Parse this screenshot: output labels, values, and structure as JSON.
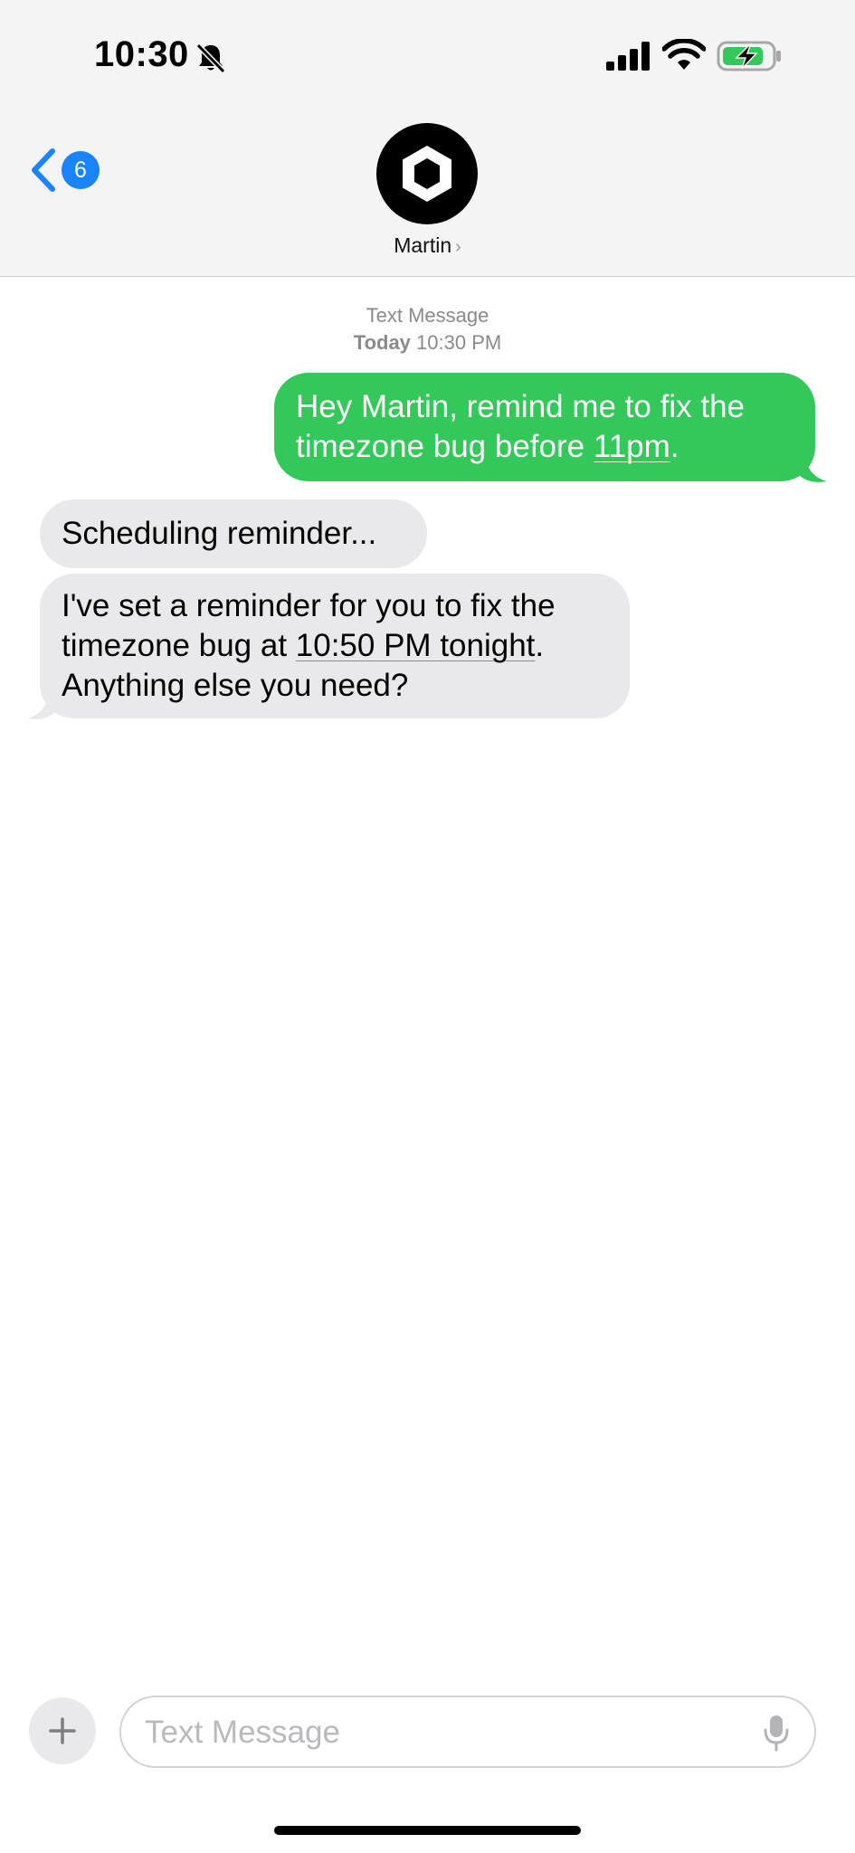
{
  "status_bar": {
    "time": "10:30",
    "icons": [
      "bell-slash-icon",
      "cellular-signal-icon",
      "wifi-icon",
      "battery-charging-icon"
    ]
  },
  "nav": {
    "back_badge": "6",
    "contact_name": "Martin",
    "contact_chevron": "›"
  },
  "conversation": {
    "service": "Text Message",
    "date_label": "Today",
    "time_label": "10:30 PM",
    "messages": [
      {
        "direction": "outgoing",
        "text_before": "Hey Martin, remind me to fix the timezone bug before ",
        "link": "11pm",
        "text_after": "."
      },
      {
        "direction": "incoming",
        "text": "Scheduling reminder..."
      },
      {
        "direction": "incoming",
        "text_before": "I've set a reminder for you to fix the timezone bug at ",
        "link": "10:50 PM tonight",
        "text_after": ". Anything else you need?"
      }
    ]
  },
  "composer": {
    "placeholder": "Text Message",
    "value": ""
  },
  "colors": {
    "sent_bubble": "#34c759",
    "received_bubble": "#e9e9eb",
    "accent": "#1a84ff",
    "header_bg": "#f4f4f4"
  }
}
